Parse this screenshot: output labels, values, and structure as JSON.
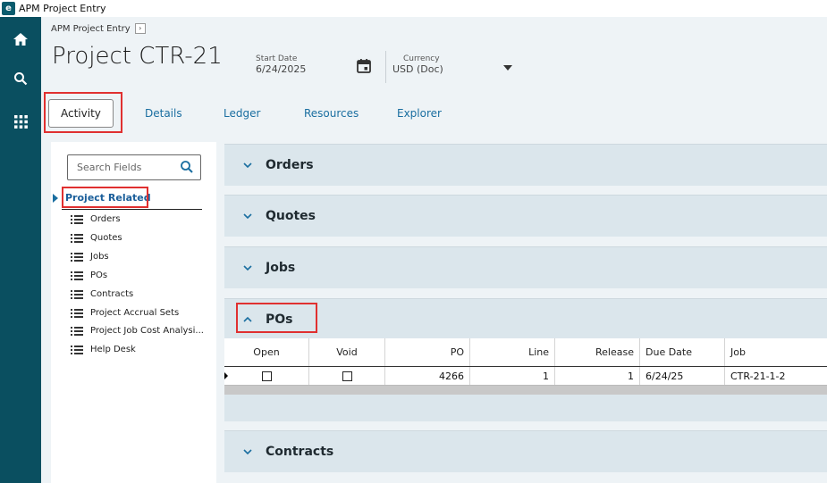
{
  "window": {
    "title": "APM Project Entry",
    "app_icon": "e-logo-icon"
  },
  "rail": {
    "items": [
      {
        "icon": "home-icon"
      },
      {
        "icon": "search-icon"
      },
      {
        "icon": "grid-icon"
      }
    ]
  },
  "header": {
    "breadcrumb": "APM Project Entry",
    "title": "Project CTR-21",
    "start_date": {
      "label": "Start Date",
      "value": "6/24/2025"
    },
    "currency": {
      "label": "Currency",
      "value": "USD (Doc)"
    }
  },
  "tabs": [
    {
      "label": "Activity",
      "active": true
    },
    {
      "label": "Details"
    },
    {
      "label": "Ledger"
    },
    {
      "label": "Resources"
    },
    {
      "label": "Explorer"
    }
  ],
  "tree": {
    "search_placeholder": "Search Fields",
    "root": "Project Related",
    "items": [
      "Orders",
      "Quotes",
      "Jobs",
      "POs",
      "Contracts",
      "Project Accrual Sets",
      "Project Job Cost Analysi...",
      "Help Desk"
    ]
  },
  "sections": {
    "orders": "Orders",
    "quotes": "Quotes",
    "jobs": "Jobs",
    "pos": "POs",
    "contracts": "Contracts"
  },
  "po_grid": {
    "columns": [
      "Open",
      "Void",
      "PO",
      "Line",
      "Release",
      "Due Date",
      "Job"
    ],
    "rows": [
      {
        "open": false,
        "void": false,
        "po": "4266",
        "line": "1",
        "release": "1",
        "due_date": "6/24/25",
        "job": "CTR-21-1-2"
      }
    ]
  },
  "colors": {
    "rail": "#0a4f60",
    "accent": "#1a6ea0",
    "highlight": "#e03030",
    "section_bg": "#dbe6ec"
  }
}
